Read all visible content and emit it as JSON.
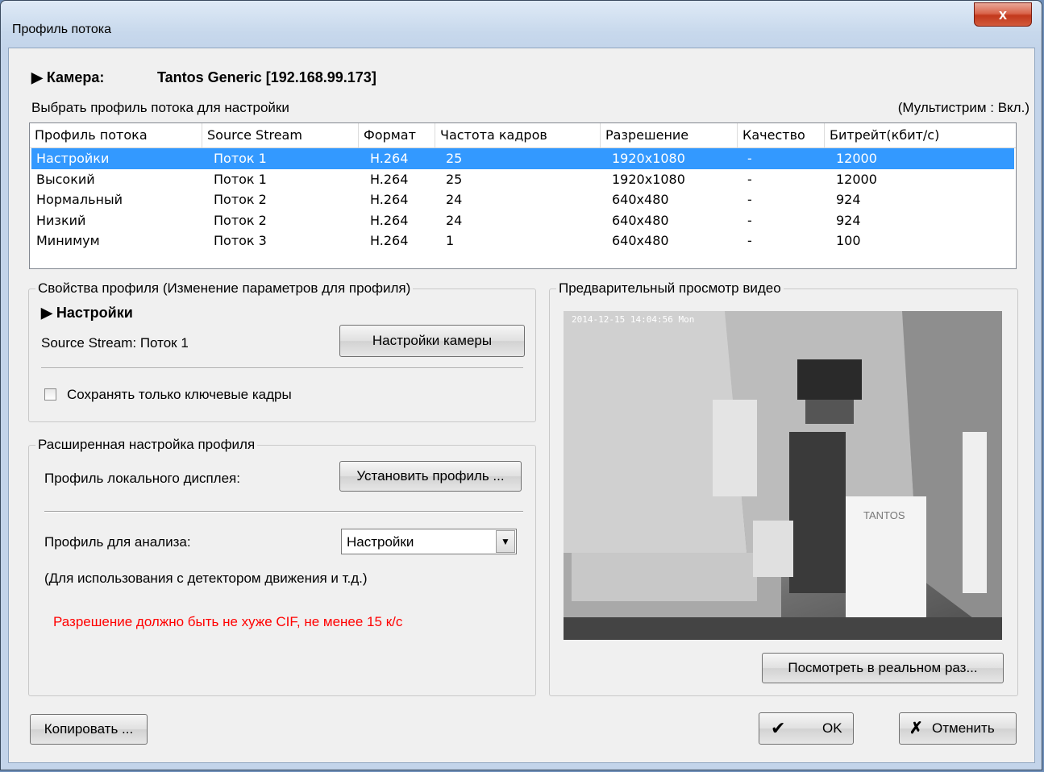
{
  "window": {
    "title": "Профиль потока",
    "close_label": "x"
  },
  "camera": {
    "label": "▶ Камера:",
    "value": "Tantos Generic [192.168.99.173]"
  },
  "select_profile_label": "Выбрать профиль потока для настройки",
  "multistream_status": "(Мультистрим : Вкл.)",
  "table": {
    "columns": [
      "Профиль потока",
      "Source Stream",
      "Формат",
      "Частота кадров",
      "Разрешение",
      "Качество",
      "Битрейт(кбит/с)"
    ],
    "rows": [
      [
        "Настройки",
        "Поток 1",
        "H.264",
        "25",
        "1920x1080",
        "-",
        "12000"
      ],
      [
        "Высокий",
        "Поток 1",
        "H.264",
        "25",
        "1920x1080",
        "-",
        "12000"
      ],
      [
        "Нормальный",
        "Поток 2",
        "H.264",
        "24",
        "640x480",
        "-",
        "924"
      ],
      [
        "Низкий",
        "Поток 2",
        "H.264",
        "24",
        "640x480",
        "-",
        "924"
      ],
      [
        "Минимум",
        "Поток 3",
        "H.264",
        "1",
        "640x480",
        "-",
        "100"
      ]
    ],
    "selected_row": 0
  },
  "profile_props": {
    "legend": "Свойства профиля (Изменение параметров для профиля)",
    "name": "▶ Настройки",
    "source_stream": "Source Stream: Поток 1",
    "camera_settings_button": "Настройки камеры",
    "keyframes_checkbox": "Сохранять только ключевые кадры",
    "keyframes_checked": false
  },
  "advanced": {
    "legend": "Расширенная настройка профиля",
    "local_display_label": "Профиль локального дисплея:",
    "set_profile_button": "Установить профиль ...",
    "analysis_label": "Профиль для анализа:",
    "analysis_value": "Настройки",
    "analysis_note": "(Для использования с детектором движения и т.д.)",
    "warning": "Разрешение должно быть не хуже CIF, не менее 15 к/с"
  },
  "preview": {
    "legend": "Предварительный просмотр видео",
    "timestamp": "2014-12-15 14:04:56 Mon",
    "brand_text": "TANTOS",
    "realsize_button": "Посмотреть в реальном раз..."
  },
  "buttons": {
    "copy": "Копировать ...",
    "ok": "OK",
    "cancel": "Отменить"
  },
  "colors": {
    "selection": "#3399ff",
    "warning": "#ff0000"
  }
}
